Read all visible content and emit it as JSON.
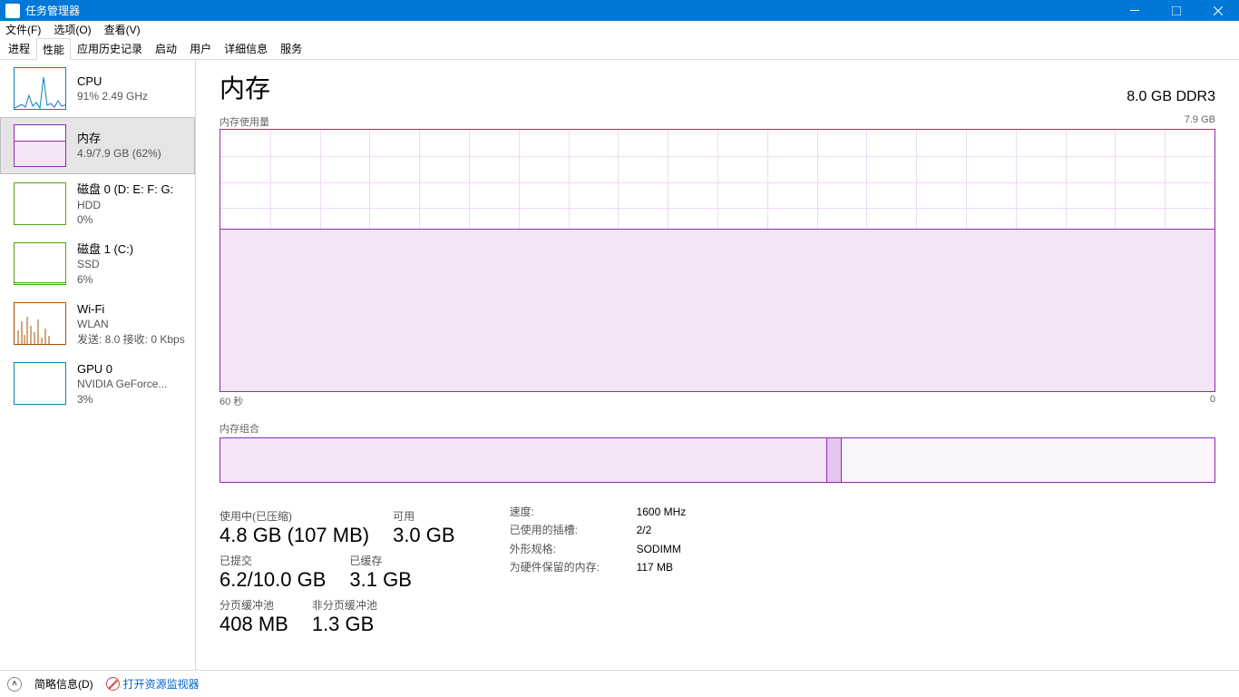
{
  "window": {
    "title": "任务管理器"
  },
  "menu": {
    "file": "文件(F)",
    "options": "选项(O)",
    "view": "查看(V)"
  },
  "tabs": [
    "进程",
    "性能",
    "应用历史记录",
    "启动",
    "用户",
    "详细信息",
    "服务"
  ],
  "activeTab": 1,
  "sidebar": [
    {
      "title": "CPU",
      "line2": "91% 2.49 GHz",
      "kind": "cpu"
    },
    {
      "title": "内存",
      "line2": "4.9/7.9 GB (62%)",
      "kind": "mem",
      "selected": true
    },
    {
      "title": "磁盘 0 (D: E: F: G:",
      "line2": "HDD",
      "line3": "0%",
      "kind": "disk"
    },
    {
      "title": "磁盘 1 (C:)",
      "line2": "SSD",
      "line3": "6%",
      "kind": "disk"
    },
    {
      "title": "Wi-Fi",
      "line2": "WLAN",
      "line3": "发送: 8.0 接收: 0 Kbps",
      "kind": "wifi"
    },
    {
      "title": "GPU 0",
      "line2": "NVIDIA GeForce...",
      "line3": "3%",
      "kind": "gpu"
    }
  ],
  "main": {
    "title": "内存",
    "installed": "8.0 GB DDR3",
    "usageLabel": "内存使用量",
    "usageMax": "7.9 GB",
    "xaxisLeft": "60 秒",
    "xaxisRight": "0",
    "compLabel": "内存组合",
    "stats": {
      "inuse_label": "使用中(已压缩)",
      "inuse_value": "4.8 GB (107 MB)",
      "avail_label": "可用",
      "avail_value": "3.0 GB",
      "committed_label": "已提交",
      "committed_value": "6.2/10.0 GB",
      "cached_label": "已缓存",
      "cached_value": "3.1 GB",
      "paged_label": "分页缓冲池",
      "paged_value": "408 MB",
      "nonpaged_label": "非分页缓冲池",
      "nonpaged_value": "1.3 GB"
    },
    "kv": {
      "speed_k": "速度:",
      "speed_v": "1600 MHz",
      "slots_k": "已使用的插槽:",
      "slots_v": "2/2",
      "form_k": "外形规格:",
      "form_v": "SODIMM",
      "reserved_k": "为硬件保留的内存:",
      "reserved_v": "117 MB"
    }
  },
  "footer": {
    "fewer": "简略信息(D)",
    "resmon": "打开资源监视器"
  },
  "chart_data": {
    "type": "area",
    "title": "内存使用量",
    "ylabel": "GB",
    "ylim": [
      0,
      7.9
    ],
    "xlabel": "秒",
    "xlim": [
      60,
      0
    ],
    "series": [
      {
        "name": "使用中",
        "value_pct": 62
      }
    ],
    "composition_pct": {
      "inuse": 61,
      "modified": 1.5,
      "standby": 37.5
    }
  }
}
